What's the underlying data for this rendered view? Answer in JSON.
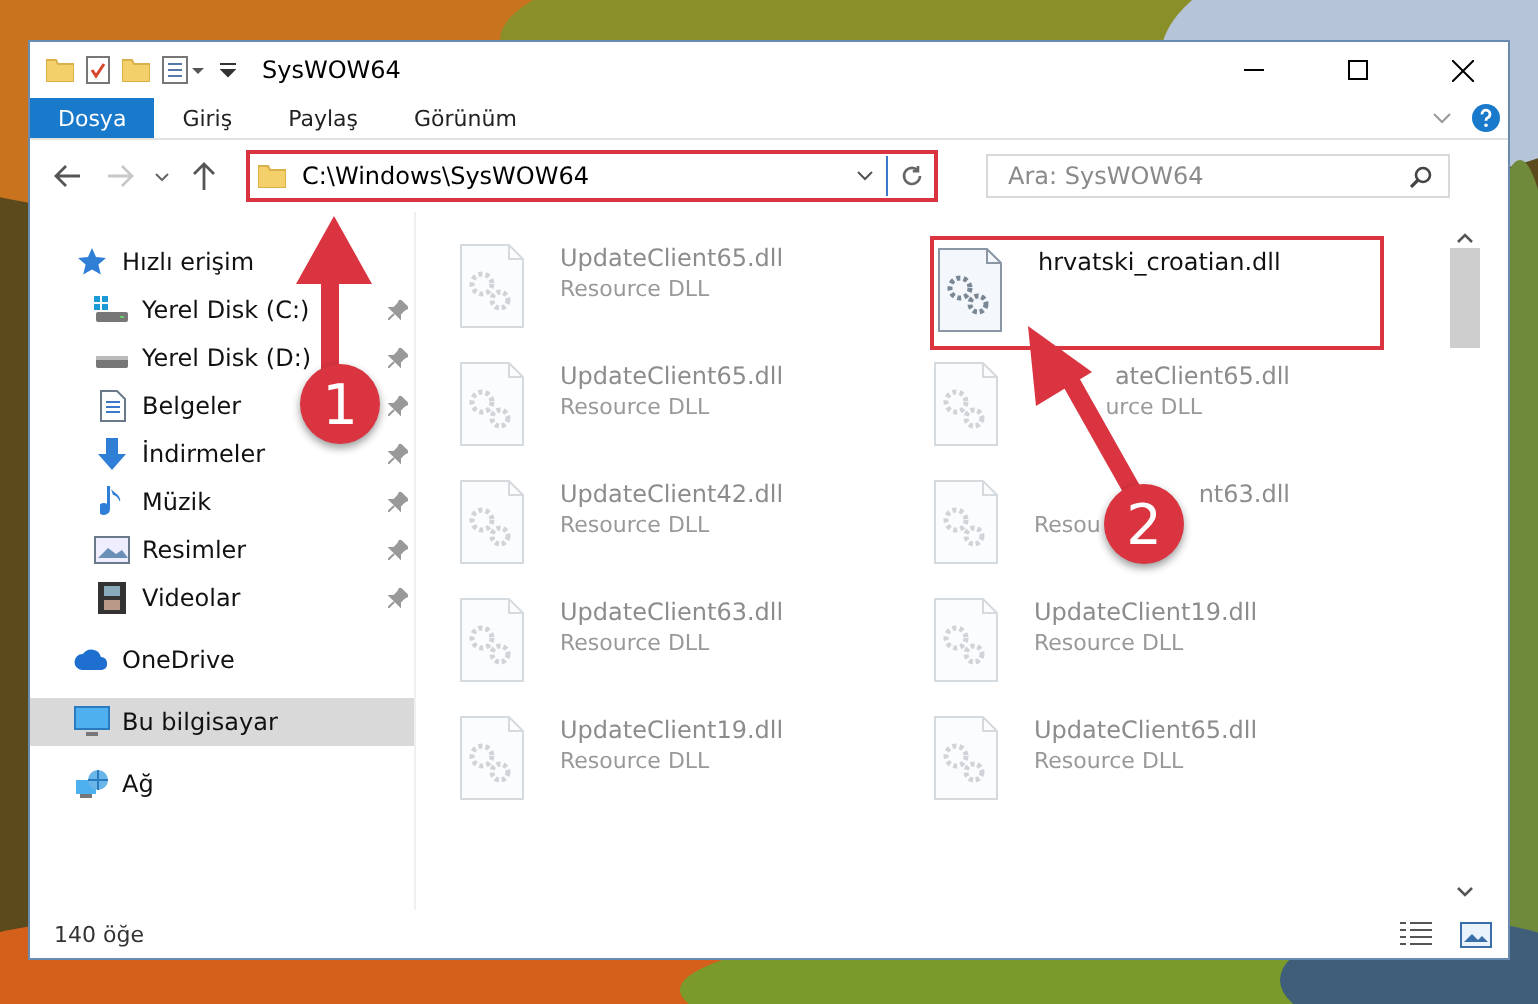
{
  "window": {
    "title": "SysWOW64"
  },
  "ribbon_tabs": [
    {
      "label": "Dosya",
      "selected": true
    },
    {
      "label": "Giriş",
      "selected": false
    },
    {
      "label": "Paylaş",
      "selected": false
    },
    {
      "label": "Görünüm",
      "selected": false
    }
  ],
  "address": {
    "path": "C:\\Windows\\SysWOW64",
    "highlighted": true
  },
  "search": {
    "placeholder": "Ara: SysWOW64"
  },
  "sidebar": {
    "items": [
      {
        "label": "Hızlı erişim",
        "selected": false,
        "children": [
          {
            "label": "Yerel Disk (C:)",
            "pinned": true
          },
          {
            "label": "Yerel Disk (D:)",
            "pinned": true
          },
          {
            "label": "Belgeler",
            "pinned": true
          },
          {
            "label": "İndirmeler",
            "pinned": true
          },
          {
            "label": "Müzik",
            "pinned": true
          },
          {
            "label": "Resimler",
            "pinned": true
          },
          {
            "label": "Videolar",
            "pinned": true
          }
        ]
      },
      {
        "label": "OneDrive",
        "selected": false
      },
      {
        "label": "Bu bilgisayar",
        "selected": true
      },
      {
        "label": "Ağ",
        "selected": false
      }
    ]
  },
  "files": [
    {
      "name": "UpdateClient65.dll",
      "type": "Resource DLL",
      "dimmed": true,
      "highlighted": false
    },
    {
      "name": "hrvatski_croatian.dll",
      "dimmed": false,
      "highlighted": true
    },
    {
      "name": "UpdateClient65.dll",
      "type": "Resource DLL",
      "dimmed": true,
      "highlighted": false
    },
    {
      "name": "ateClient65.dll",
      "type": "urce DLL",
      "dimmed": true,
      "highlighted": false,
      "kind": "tail"
    },
    {
      "name": "UpdateClient42.dll",
      "type": "Resource DLL",
      "dimmed": true,
      "highlighted": false
    },
    {
      "name": "nt63.dll",
      "type": "Resou",
      "dimmed": true,
      "highlighted": false,
      "kind": "name-tail"
    },
    {
      "name": "UpdateClient63.dll",
      "type": "Resource DLL",
      "dimmed": true,
      "highlighted": false
    },
    {
      "name": "UpdateClient19.dll",
      "type": "Resource DLL",
      "dimmed": true,
      "highlighted": false
    },
    {
      "name": "UpdateClient19.dll",
      "type": "Resource DLL",
      "dimmed": true,
      "highlighted": false
    },
    {
      "name": "UpdateClient65.dll",
      "type": "Resource DLL",
      "dimmed": true,
      "highlighted": false
    }
  ],
  "status_bar": {
    "count": "140 öğe"
  },
  "callouts": [
    {
      "number": "1"
    },
    {
      "number": "2"
    }
  ]
}
